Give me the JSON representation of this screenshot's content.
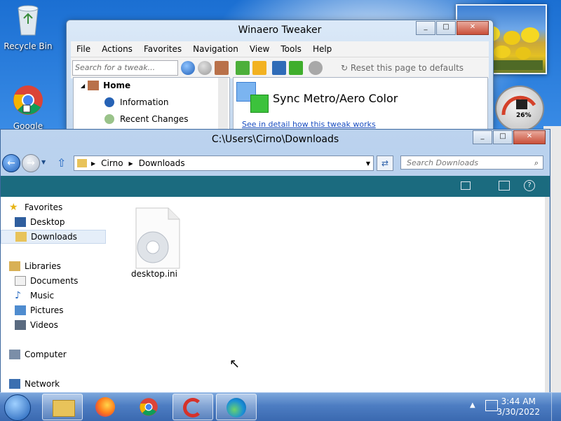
{
  "desktop": {
    "icons": [
      {
        "label": "Recycle Bin",
        "icon": "recycle-bin-icon"
      },
      {
        "label": "Google",
        "icon": "chrome-icon"
      }
    ],
    "gauge_value": "26%"
  },
  "winaero": {
    "title": "Winaero Tweaker",
    "menu": [
      "File",
      "Actions",
      "Favorites",
      "Navigation",
      "View",
      "Tools",
      "Help"
    ],
    "search_placeholder": "Search for a tweak...",
    "reset_label": "Reset this page to defaults",
    "tree": [
      {
        "label": "Home",
        "bold": true,
        "icon": "home-icon"
      },
      {
        "label": "Information",
        "icon": "info-icon"
      },
      {
        "label": "Recent Changes",
        "icon": "history-icon"
      }
    ],
    "content_title": "Sync Metro/Aero Color",
    "content_link": "See in detail how this tweak works"
  },
  "explorer": {
    "title": "C:\\Users\\Cirno\\Downloads",
    "breadcrumb": [
      "Cirno",
      "Downloads"
    ],
    "search_placeholder": "Search Downloads",
    "nav": {
      "favorites_label": "Favorites",
      "favorites": [
        {
          "label": "Desktop",
          "icon": "desktop-folder-icon"
        },
        {
          "label": "Downloads",
          "icon": "downloads-folder-icon",
          "selected": true
        }
      ],
      "libraries_label": "Libraries",
      "libraries": [
        {
          "label": "Documents",
          "icon": "documents-icon"
        },
        {
          "label": "Music",
          "icon": "music-icon"
        },
        {
          "label": "Pictures",
          "icon": "pictures-icon"
        },
        {
          "label": "Videos",
          "icon": "videos-icon"
        }
      ],
      "computer_label": "Computer",
      "network_label": "Network"
    },
    "files": [
      {
        "name": "desktop.ini",
        "icon": "settings-file-icon"
      }
    ]
  },
  "taskbar": {
    "apps": [
      "start-orb-icon",
      "explorer-icon",
      "firefox-icon",
      "chrome-icon",
      "ccleaner-icon",
      "edge-icon"
    ],
    "clock_time": "3:44 AM",
    "clock_date": "3/30/2022"
  }
}
